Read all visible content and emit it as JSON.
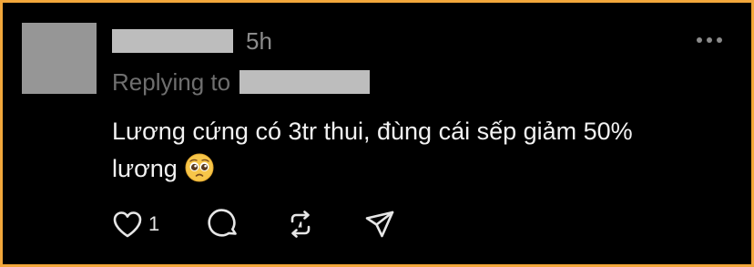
{
  "post": {
    "timestamp": "5h",
    "replying_label": "Replying to",
    "body_line1": "Lương cứng có 3tr thui, đùng cái sếp giảm 50%",
    "body_line2": "lương",
    "emoji": "pleading-face",
    "like_count": "1"
  },
  "icons": {
    "more": "more-horizontal-icon",
    "like": "heart-icon",
    "comment": "comment-icon",
    "repost": "repost-icon",
    "share": "share-icon"
  },
  "colors": {
    "border": "#f2a73b",
    "background": "#000000",
    "text": "#f2f2f2",
    "muted": "#8b8b8b"
  }
}
